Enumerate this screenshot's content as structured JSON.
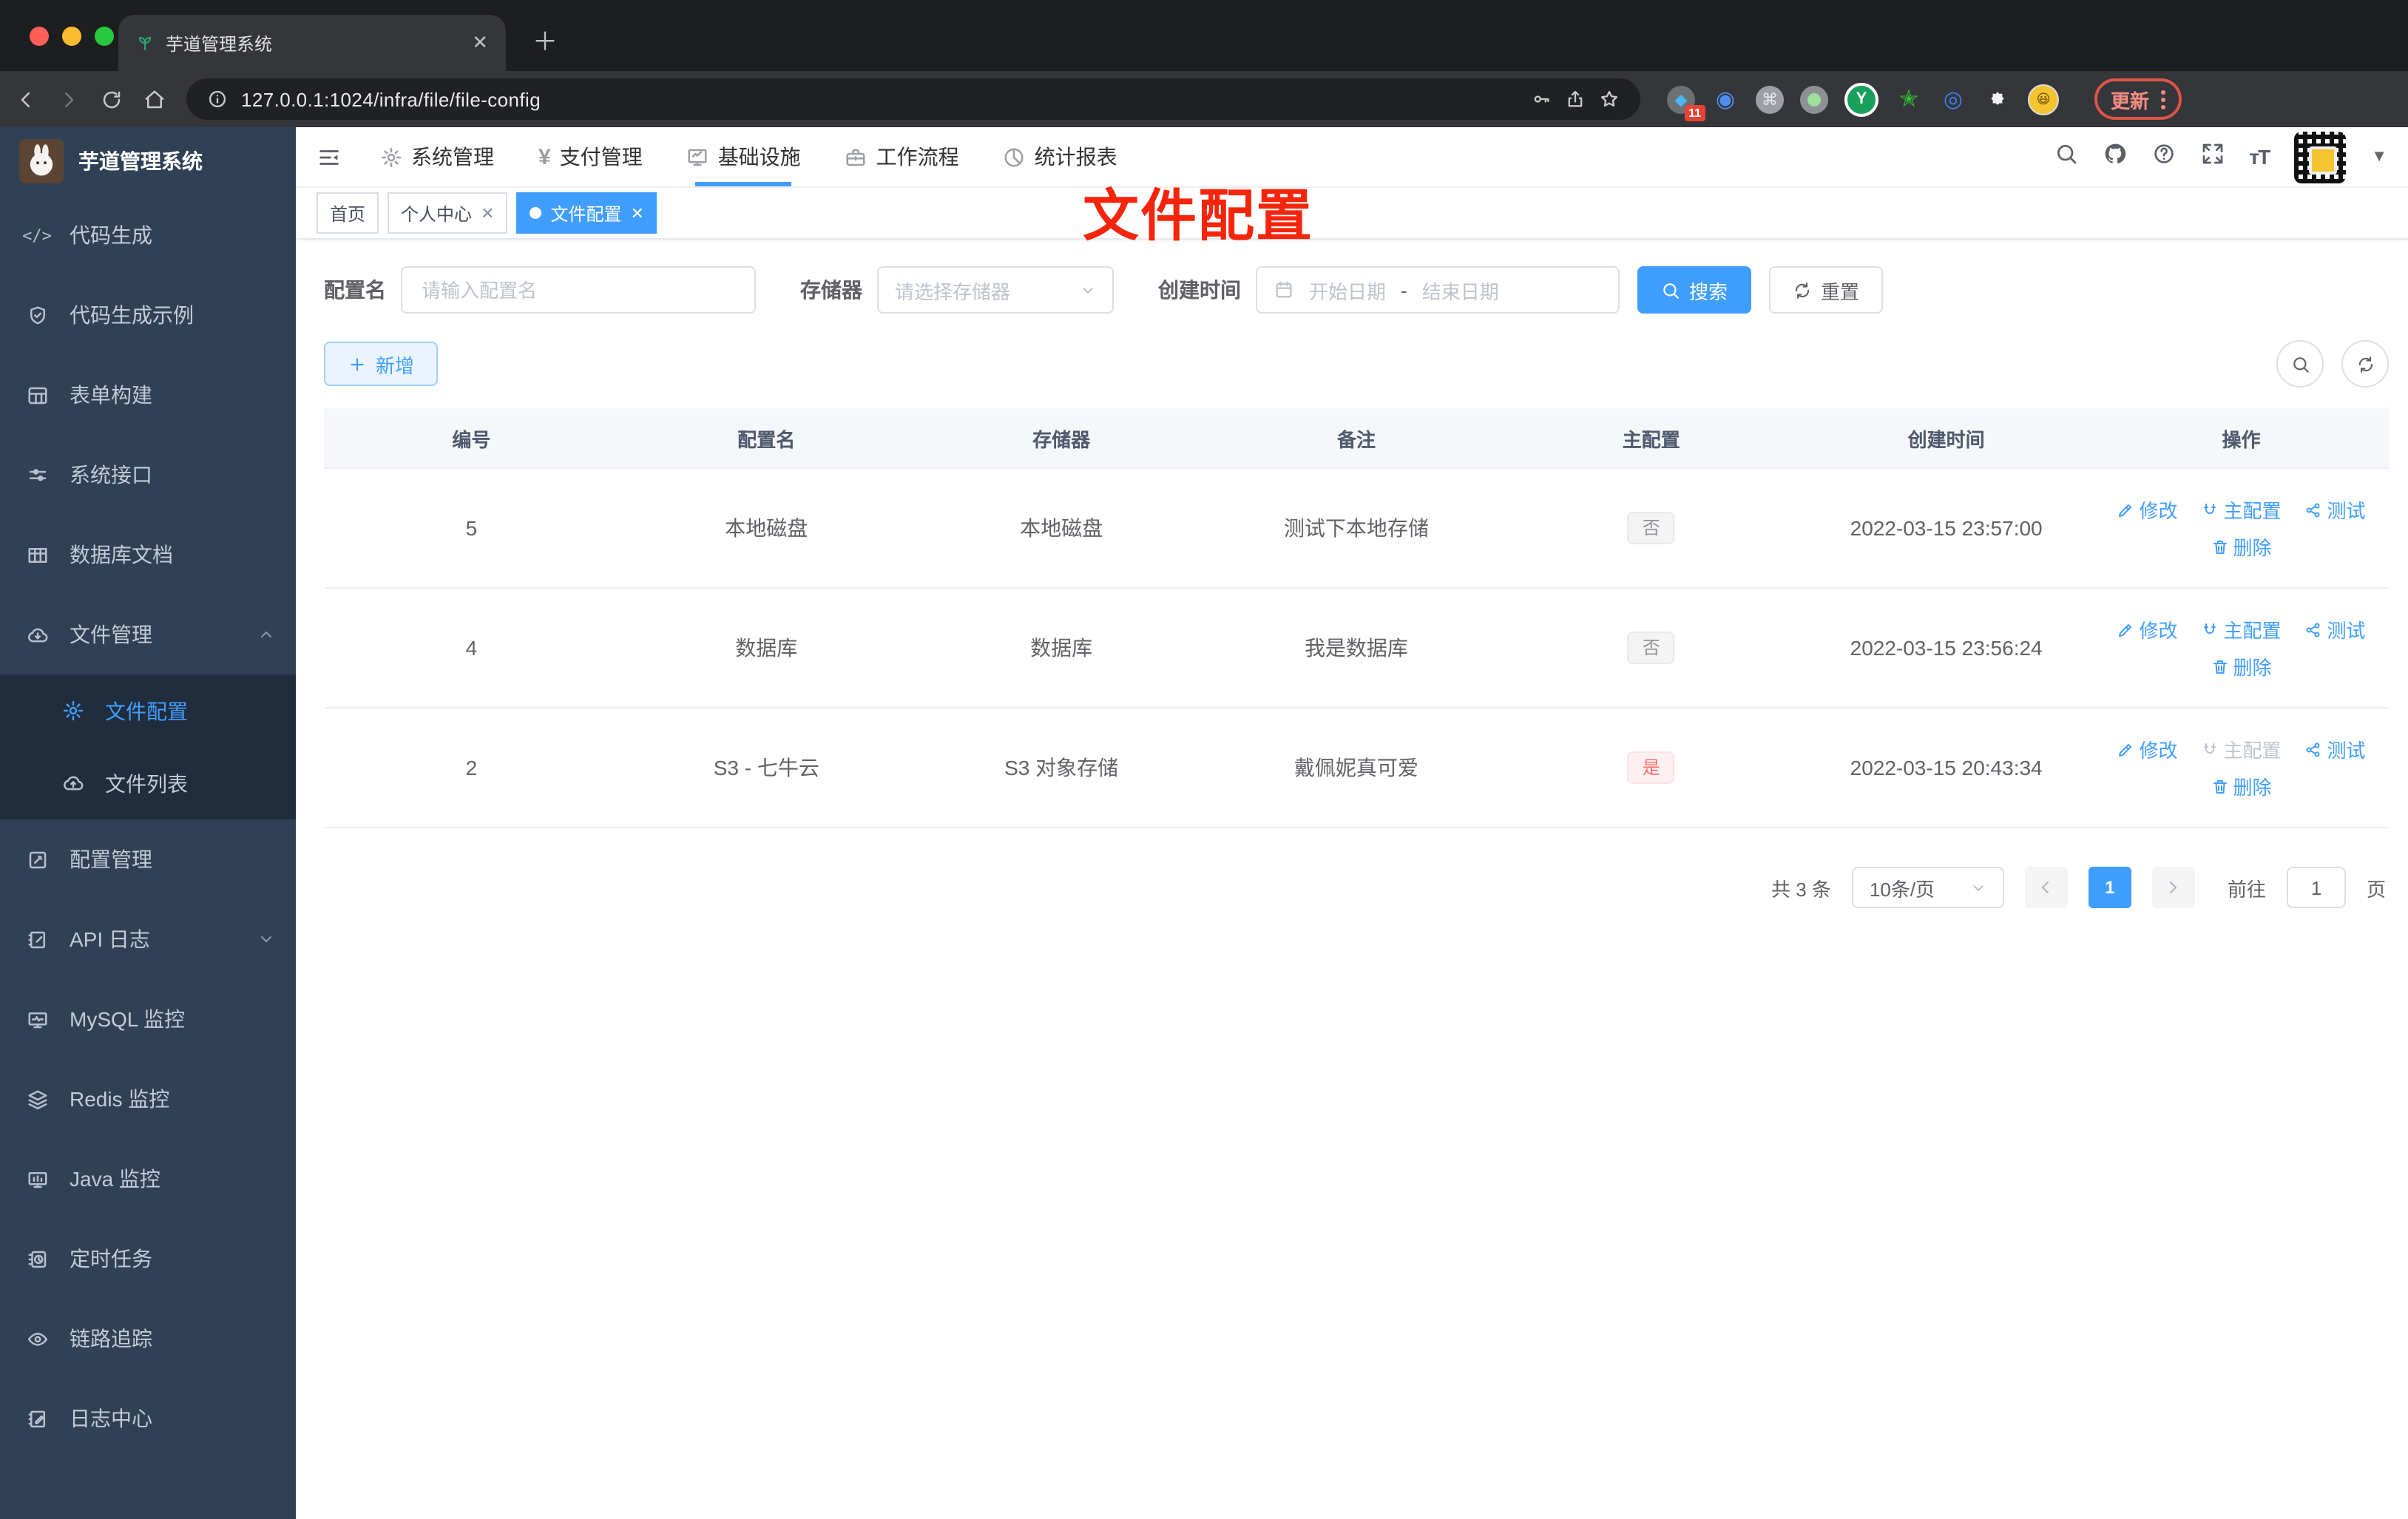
{
  "browser": {
    "tab_title": "芋道管理系统",
    "url": "127.0.0.1:1024/infra/file/file-config",
    "extension_badge": "11",
    "extension_y": "Y",
    "update_label": "更新"
  },
  "colors": {
    "accent": "#409eff",
    "overlay_red": "#f5250b",
    "danger": "#f56c6c",
    "sidebar_bg": "#304156",
    "submenu_bg": "#1f2d3d"
  },
  "sidebar": {
    "title": "芋道管理系统",
    "items": [
      {
        "label": "代码生成"
      },
      {
        "label": "代码生成示例"
      },
      {
        "label": "表单构建"
      },
      {
        "label": "系统接口"
      },
      {
        "label": "数据库文档"
      },
      {
        "label": "文件管理"
      },
      {
        "label": "文件配置"
      },
      {
        "label": "文件列表"
      },
      {
        "label": "配置管理"
      },
      {
        "label": "API 日志"
      },
      {
        "label": "MySQL 监控"
      },
      {
        "label": "Redis 监控"
      },
      {
        "label": "Java 监控"
      },
      {
        "label": "定时任务"
      },
      {
        "label": "链路追踪"
      },
      {
        "label": "日志中心"
      }
    ]
  },
  "topnav": {
    "items": [
      {
        "label": "系统管理"
      },
      {
        "label": "支付管理"
      },
      {
        "label": "基础设施"
      },
      {
        "label": "工作流程"
      },
      {
        "label": "统计报表"
      }
    ]
  },
  "tags": {
    "home": "首页",
    "profile": "个人中心",
    "current": "文件配置"
  },
  "overlay_title": "文件配置",
  "filters": {
    "name_label": "配置名",
    "name_placeholder": "请输入配置名",
    "storage_label": "存储器",
    "storage_placeholder": "请选择存储器",
    "time_label": "创建时间",
    "start_placeholder": "开始日期",
    "range_separator": "-",
    "end_placeholder": "结束日期",
    "search_label": "搜索",
    "reset_label": "重置"
  },
  "toolbar": {
    "add_label": "新增"
  },
  "table": {
    "headers": [
      "编号",
      "配置名",
      "存储器",
      "备注",
      "主配置",
      "创建时间",
      "操作"
    ],
    "actions": {
      "edit": "修改",
      "master": "主配置",
      "test": "测试",
      "delete": "删除"
    },
    "rows": [
      {
        "id": "5",
        "name": "本地磁盘",
        "storage": "本地磁盘",
        "remark": "测试下本地存储",
        "master": "否",
        "created": "2022-03-15 23:57:00"
      },
      {
        "id": "4",
        "name": "数据库",
        "storage": "数据库",
        "remark": "我是数据库",
        "master": "否",
        "created": "2022-03-15 23:56:24"
      },
      {
        "id": "2",
        "name": "S3 - 七牛云",
        "storage": "S3 对象存储",
        "remark": "戴佩妮真可爱",
        "master": "是",
        "created": "2022-03-15 20:43:34"
      }
    ]
  },
  "pagination": {
    "total": "共 3 条",
    "page_size": "10条/页",
    "current_page": "1",
    "goto_label": "前往",
    "goto_value": "1",
    "page_unit": "页"
  }
}
